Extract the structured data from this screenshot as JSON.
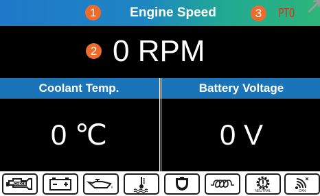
{
  "header": {
    "title": "Engine Speed",
    "pto_label": "PTO",
    "markers": [
      "1",
      "3"
    ],
    "colors": {
      "gradient_start": "#1f78c8",
      "gradient_end": "#2cb679",
      "marker": "#ee6b2e",
      "pto": "#e0341f"
    }
  },
  "speed": {
    "marker": "2",
    "value": "0 RPM"
  },
  "panels": {
    "left": {
      "label": "Coolant Temp.",
      "value": "0 ℃"
    },
    "right": {
      "label": "Battery Voltage",
      "value": "0 V"
    },
    "label_color": "#1c74b8"
  },
  "indicators": [
    {
      "name": "check-engine-icon"
    },
    {
      "name": "battery-icon"
    },
    {
      "name": "oil-pressure-icon"
    },
    {
      "name": "coolant-temperature-icon"
    },
    {
      "name": "fuel-water-separator-icon"
    },
    {
      "name": "glow-plug-icon"
    },
    {
      "name": "neutral-gear-icon",
      "label": "NEUTRAL"
    },
    {
      "name": "can-signal-icon",
      "label": "CAN"
    }
  ]
}
